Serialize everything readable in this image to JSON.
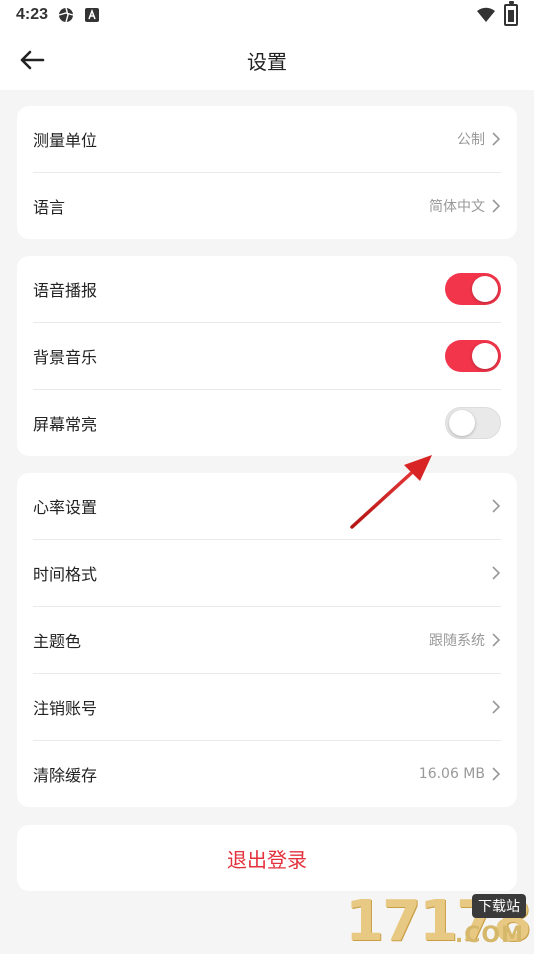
{
  "status_bar": {
    "time": "4:23",
    "icons": [
      "aperture-icon",
      "a-badge-icon",
      "wifi-icon",
      "battery-icon"
    ]
  },
  "header": {
    "title": "设置",
    "back_icon": "arrow-left-icon"
  },
  "groups": [
    {
      "items": [
        {
          "label": "测量单位",
          "value": "公制"
        },
        {
          "label": "语言",
          "value": "简体中文"
        }
      ]
    },
    {
      "items": [
        {
          "label": "语音播报",
          "toggle": "on"
        },
        {
          "label": "背景音乐",
          "toggle": "on"
        },
        {
          "label": "屏幕常亮",
          "toggle": "off"
        }
      ]
    },
    {
      "items": [
        {
          "label": "心率设置",
          "value": ""
        },
        {
          "label": "时间格式",
          "value": ""
        },
        {
          "label": "主题色",
          "value": "跟随系统"
        },
        {
          "label": "注销账号",
          "value": ""
        },
        {
          "label": "清除缓存",
          "value": "16.06 MB"
        }
      ]
    }
  ],
  "logout": {
    "label": "退出登录"
  },
  "watermark": {
    "digits": "17178",
    "badge": "下载站",
    "domain": ".COM"
  },
  "colors": {
    "accent": "#f2354a",
    "logout_text": "#e3323d",
    "background": "#f5f5f5",
    "annotation_arrow": "#d82424"
  }
}
